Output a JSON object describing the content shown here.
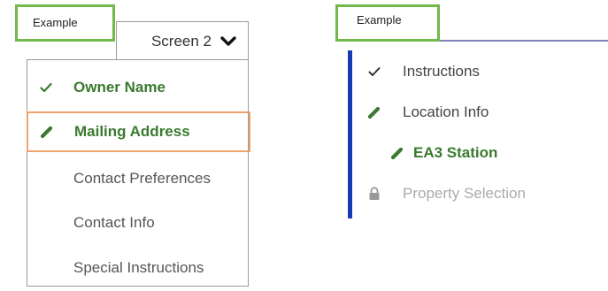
{
  "left_example": {
    "tag": "Example",
    "screen_select": "Screen 2",
    "menu_items": [
      {
        "label": "Owner Name",
        "icon": "check-icon",
        "state": "completed"
      },
      {
        "label": "Mailing Address",
        "icon": "pencil-icon",
        "state": "active"
      },
      {
        "label": "Contact Preferences",
        "icon": "",
        "state": "pending"
      },
      {
        "label": "Contact Info",
        "icon": "",
        "state": "pending"
      },
      {
        "label": "Special Instructions",
        "icon": "",
        "state": "pending"
      }
    ]
  },
  "right_example": {
    "tag": "Example",
    "nav_items": [
      {
        "label": "Instructions",
        "icon": "check-icon",
        "state": "completed"
      },
      {
        "label": "Location Info",
        "icon": "pencil-icon",
        "state": "in-progress"
      },
      {
        "label": "EA3 Station",
        "icon": "pencil-icon",
        "state": "active-subitem"
      },
      {
        "label": "Property Selection",
        "icon": "lock-icon",
        "state": "locked"
      }
    ]
  },
  "colors": {
    "tag_border": "#72b94a",
    "green": "#3a7a2f",
    "active_border": "#f0a36a",
    "vertical_bar": "#1a39b5",
    "disabled_text": "#aaaaaa"
  }
}
